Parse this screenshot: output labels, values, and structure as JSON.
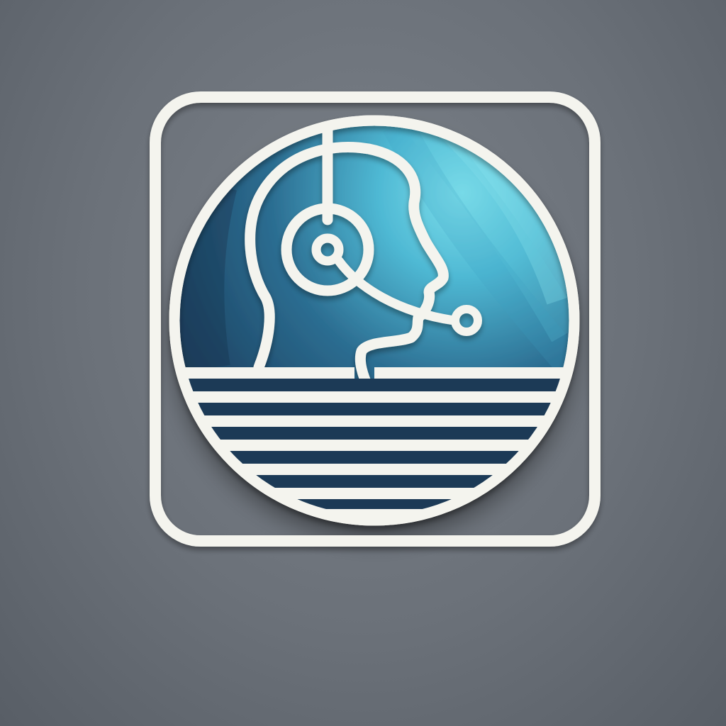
{
  "icon": {
    "name": "customer-support-headset-icon",
    "description_label": "",
    "colors": {
      "background": "#6b7179",
      "outline": "#f4f4ee",
      "globe_dark": "#1d3f5e",
      "globe_mid": "#2f7294",
      "globe_light": "#6fd3e3"
    }
  }
}
